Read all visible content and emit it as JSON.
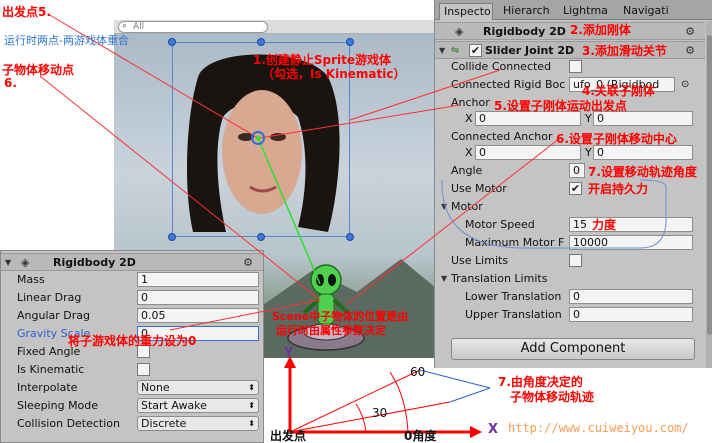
{
  "scene": {
    "search_placeholder": "All"
  },
  "inspector": {
    "tabs": [
      "Inspecto",
      "Hierarch",
      "Lightma",
      "Navigati"
    ],
    "rigidbody_header": "Rigidbody 2D",
    "slider_joint_header": "Slider Joint 2D",
    "collide_connected_label": "Collide Connected",
    "connected_rigidbody_label": "Connected Rigid Boc",
    "connected_rigidbody_value": "ufo_0 (Rigidbod",
    "anchor_label": "Anchor",
    "anchor_x": "0",
    "anchor_y": "0",
    "connected_anchor_label": "Connected Anchor",
    "connected_anchor_x": "0",
    "connected_anchor_y": "0",
    "angle_label": "Angle",
    "angle_value": "0",
    "use_motor_label": "Use Motor",
    "motor_label": "Motor",
    "motor_speed_label": "Motor Speed",
    "motor_speed_value": "15",
    "max_motor_label": "Maximum Motor F",
    "max_motor_value": "10000",
    "use_limits_label": "Use Limits",
    "translation_limits_label": "Translation Limits",
    "lower_translation_label": "Lower Translation",
    "lower_translation_value": "0",
    "upper_translation_label": "Upper Translation",
    "upper_translation_value": "0",
    "add_component": "Add Component",
    "x_label": "X",
    "y_label": "Y"
  },
  "rigidbody2": {
    "header": "Rigidbody 2D",
    "mass_label": "Mass",
    "mass_value": "1",
    "linear_drag_label": "Linear Drag",
    "linear_drag_value": "0",
    "angular_drag_label": "Angular Drag",
    "angular_drag_value": "0.05",
    "gravity_scale_label": "Gravity Scale",
    "gravity_scale_value": "0",
    "fixed_angle_label": "Fixed Angle",
    "is_kinematic_label": "Is Kinematic",
    "interpolate_label": "Interpolate",
    "interpolate_value": "None",
    "sleeping_mode_label": "Sleeping Mode",
    "sleeping_mode_value": "Start Awake",
    "collision_detection_label": "Collision Detection",
    "collision_detection_value": "Discrete"
  },
  "annotations": {
    "a_start_point": "出发点5.",
    "a_runtime": "运行时两点-两游戏体重合",
    "a_child_move": "子物体移动点",
    "a_child_move_num": "6.",
    "a1_line1": "1.创建静止Sprite游戏体",
    "a1_line2": "（勾选，Is Kinematic）",
    "a2": "2.添加刚体",
    "a3": "3.添加滑动关节",
    "a4": "4.关联子刚体",
    "a5": "5.设置子刚体运动出发点",
    "a6": "6.设置子刚体移动中心",
    "a7": "7.设置移动轨迹角度",
    "a_motor_on": "开启持久力",
    "a_force": "力度",
    "a_gravity": "将子游戏体的重力设为0",
    "a_scene_line1": "Scene中子物体的位置是由",
    "a_scene_line2": "运行时由属性参数决定",
    "a_traj_line1": "7.由角度决定的",
    "a_traj_line2": "子物体移动轨迹",
    "d_y": "Y",
    "d_x": "X",
    "d_60": "60",
    "d_30": "30",
    "d_start": "出发点",
    "d_zero": "0角度",
    "watermark": "http://www.cuiweiyou.com/"
  },
  "colors": {
    "annotation_red": "#ff0000",
    "annotation_blue": "#2e74d0",
    "diagram_purple": "#7030a0",
    "watermark": "#ff9c55"
  }
}
